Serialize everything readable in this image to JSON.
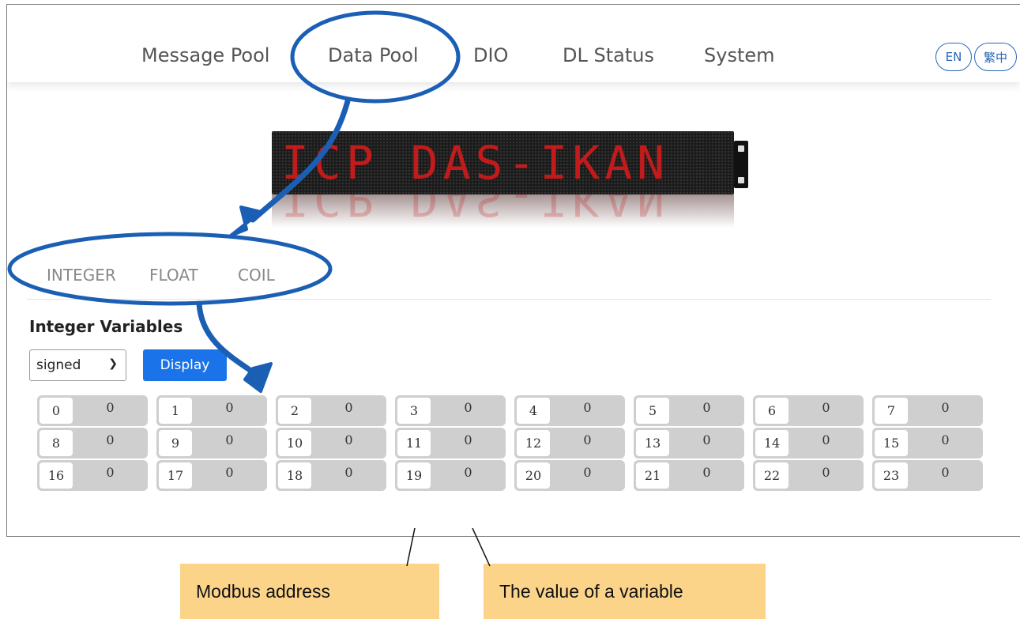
{
  "nav": {
    "items": [
      "Message Pool",
      "Data Pool",
      "DIO",
      "DL Status",
      "System"
    ],
    "lang": [
      "EN",
      "繁中"
    ]
  },
  "banner": {
    "text": "ICP DAS-IKAN"
  },
  "tabs": [
    "INTEGER",
    "FLOAT",
    "COIL"
  ],
  "integer": {
    "title": "Integer Variables",
    "select_value": "signed",
    "display_label": "Display",
    "cells": [
      {
        "addr": "0",
        "val": "0"
      },
      {
        "addr": "1",
        "val": "0"
      },
      {
        "addr": "2",
        "val": "0"
      },
      {
        "addr": "3",
        "val": "0"
      },
      {
        "addr": "4",
        "val": "0"
      },
      {
        "addr": "5",
        "val": "0"
      },
      {
        "addr": "6",
        "val": "0"
      },
      {
        "addr": "7",
        "val": "0"
      },
      {
        "addr": "8",
        "val": "0"
      },
      {
        "addr": "9",
        "val": "0"
      },
      {
        "addr": "10",
        "val": "0"
      },
      {
        "addr": "11",
        "val": "0"
      },
      {
        "addr": "12",
        "val": "0"
      },
      {
        "addr": "13",
        "val": "0"
      },
      {
        "addr": "14",
        "val": "0"
      },
      {
        "addr": "15",
        "val": "0"
      },
      {
        "addr": "16",
        "val": "0"
      },
      {
        "addr": "17",
        "val": "0"
      },
      {
        "addr": "18",
        "val": "0"
      },
      {
        "addr": "19",
        "val": "0"
      },
      {
        "addr": "20",
        "val": "0"
      },
      {
        "addr": "21",
        "val": "0"
      },
      {
        "addr": "22",
        "val": "0"
      },
      {
        "addr": "23",
        "val": "0"
      }
    ]
  },
  "annotations": {
    "modbus_address": "Modbus address",
    "variable_value": "The value of a variable",
    "highlight_color": "#1a5fb4",
    "callout_color": "#fbd48a"
  }
}
